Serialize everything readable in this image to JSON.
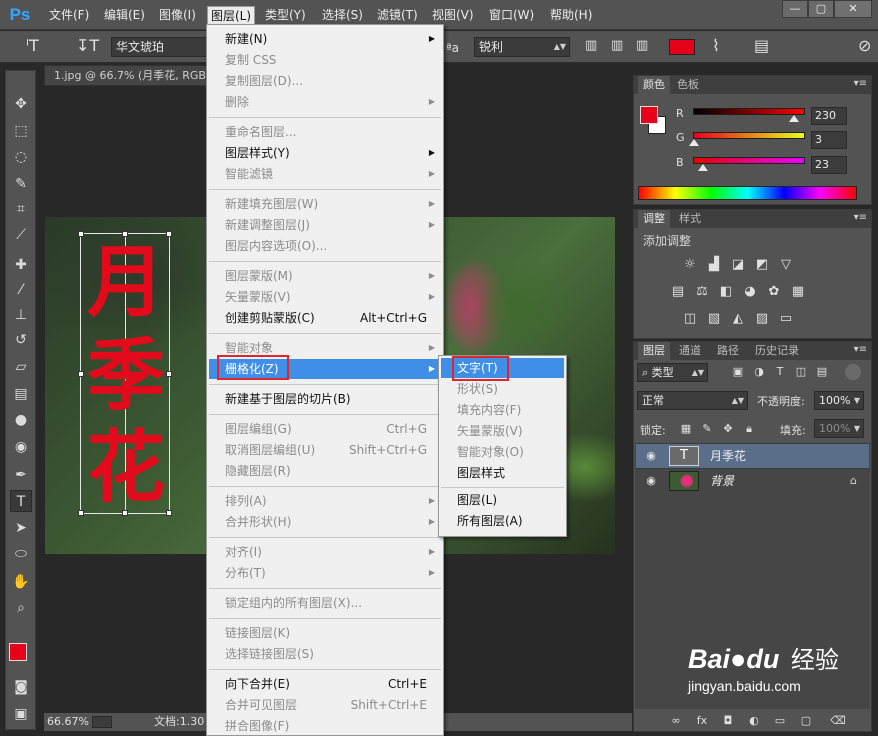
{
  "app": {
    "logo": "Ps",
    "menubar": [
      "文件(F)",
      "编辑(E)",
      "图像(I)",
      "图层(L)",
      "类型(Y)",
      "选择(S)",
      "滤镜(T)",
      "视图(V)",
      "窗口(W)",
      "帮助(H)"
    ],
    "active_menu": "图层(L)",
    "window_controls": [
      "—",
      "▢",
      "✕"
    ]
  },
  "options_bar": {
    "font_family": "华文琥珀",
    "anti_alias": "锐利",
    "aa_label": "ªa",
    "text_color": "#e6031a"
  },
  "document": {
    "tab_title": "1.jpg @ 66.7% (月季花, RGB",
    "text_layer_chars": [
      "月",
      "季",
      "花"
    ],
    "status_zoom": "66.67%",
    "status_doc": "文档:1.30"
  },
  "layer_menu": {
    "items": [
      {
        "label": "新建(N)",
        "state": "enabled",
        "submenu": true
      },
      {
        "label": "复制 CSS",
        "state": "disabled"
      },
      {
        "label": "复制图层(D)...",
        "state": "disabled"
      },
      {
        "label": "删除",
        "state": "disabled",
        "submenu": true
      },
      {
        "sep": true
      },
      {
        "label": "重命名图层...",
        "state": "disabled"
      },
      {
        "label": "图层样式(Y)",
        "state": "enabled",
        "submenu": true
      },
      {
        "label": "智能滤镜",
        "state": "disabled",
        "submenu": true
      },
      {
        "sep": true
      },
      {
        "label": "新建填充图层(W)",
        "state": "disabled",
        "submenu": true
      },
      {
        "label": "新建调整图层(J)",
        "state": "disabled",
        "submenu": true
      },
      {
        "label": "图层内容选项(O)...",
        "state": "disabled"
      },
      {
        "sep": true
      },
      {
        "label": "图层蒙版(M)",
        "state": "disabled",
        "submenu": true
      },
      {
        "label": "矢量蒙版(V)",
        "state": "disabled",
        "submenu": true
      },
      {
        "label": "创建剪贴蒙版(C)",
        "state": "enabled",
        "shortcut": "Alt+Ctrl+G"
      },
      {
        "sep": true
      },
      {
        "label": "智能对象",
        "state": "disabled",
        "submenu": true
      },
      {
        "label": "栅格化(Z)",
        "state": "highlighted",
        "submenu": true
      },
      {
        "sep": true
      },
      {
        "label": "新建基于图层的切片(B)",
        "state": "enabled"
      },
      {
        "sep": true
      },
      {
        "label": "图层编组(G)",
        "state": "disabled",
        "shortcut": "Ctrl+G"
      },
      {
        "label": "取消图层编组(U)",
        "state": "disabled",
        "shortcut": "Shift+Ctrl+G"
      },
      {
        "label": "隐藏图层(R)",
        "state": "disabled"
      },
      {
        "sep": true
      },
      {
        "label": "排列(A)",
        "state": "disabled",
        "submenu": true
      },
      {
        "label": "合并形状(H)",
        "state": "disabled",
        "submenu": true
      },
      {
        "sep": true
      },
      {
        "label": "对齐(I)",
        "state": "disabled",
        "submenu": true
      },
      {
        "label": "分布(T)",
        "state": "disabled",
        "submenu": true
      },
      {
        "sep": true
      },
      {
        "label": "锁定组内的所有图层(X)...",
        "state": "disabled"
      },
      {
        "sep": true
      },
      {
        "label": "链接图层(K)",
        "state": "disabled"
      },
      {
        "label": "选择链接图层(S)",
        "state": "disabled"
      },
      {
        "sep": true
      },
      {
        "label": "向下合并(E)",
        "state": "enabled",
        "shortcut": "Ctrl+E"
      },
      {
        "label": "合并可见图层",
        "state": "disabled",
        "shortcut": "Shift+Ctrl+E"
      },
      {
        "label": "拼合图像(F)",
        "state": "disabled"
      }
    ]
  },
  "rasterize_submenu": {
    "items": [
      {
        "label": "文字(T)",
        "state": "highlighted"
      },
      {
        "label": "形状(S)",
        "state": "disabled"
      },
      {
        "label": "填充内容(F)",
        "state": "disabled"
      },
      {
        "label": "矢量蒙版(V)",
        "state": "disabled"
      },
      {
        "label": "智能对象(O)",
        "state": "disabled"
      },
      {
        "label": "图层样式",
        "state": "enabled"
      },
      {
        "sep": true
      },
      {
        "label": "图层(L)",
        "state": "enabled"
      },
      {
        "label": "所有图层(A)",
        "state": "enabled"
      }
    ]
  },
  "color_panel": {
    "tabs": [
      "颜色",
      "色板"
    ],
    "sliders": [
      {
        "label": "R",
        "value": "230",
        "fraction": 0.902
      },
      {
        "label": "G",
        "value": "3",
        "fraction": 0.012
      },
      {
        "label": "B",
        "value": "23",
        "fraction": 0.09
      }
    ],
    "fg_color": "#e6031a"
  },
  "adjustments_panel": {
    "tabs": [
      "调整",
      "样式"
    ],
    "title": "添加调整"
  },
  "layers_panel": {
    "tabs": [
      "图层",
      "通道",
      "路径",
      "历史记录"
    ],
    "filter_label": "类型",
    "blend_mode": "正常",
    "opacity_label": "不透明度:",
    "opacity_value": "100%",
    "lock_label": "锁定:",
    "fill_label": "填充:",
    "fill_value": "100%",
    "layers": [
      {
        "name": "月季花",
        "type": "text",
        "selected": true,
        "thumb": "T"
      },
      {
        "name": "背景",
        "type": "image",
        "selected": false,
        "locked": true
      }
    ]
  },
  "watermark": {
    "brand": "Bai",
    "brand2": "du",
    "cn": "经验",
    "url": "jingyan.baidu.com"
  }
}
